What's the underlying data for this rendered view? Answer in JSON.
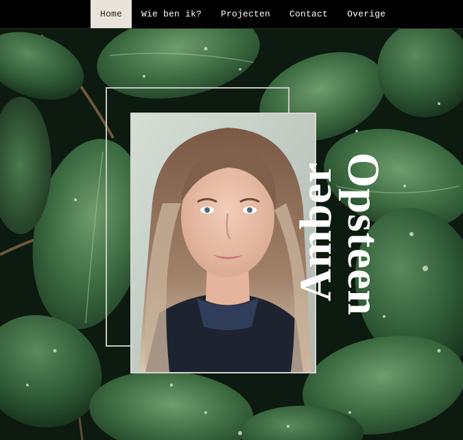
{
  "nav": {
    "items": [
      {
        "label": "Home",
        "active": true
      },
      {
        "label": "Wie ben ik?",
        "active": false
      },
      {
        "label": "Projecten",
        "active": false
      },
      {
        "label": "Contact",
        "active": false
      },
      {
        "label": "Overige",
        "active": false
      }
    ]
  },
  "hero": {
    "first_name": "Amber",
    "last_name": "Opsteen",
    "background": "green-leaves-with-water-drops"
  },
  "colors": {
    "nav_bg": "#000000",
    "nav_active_bg": "#e8e4dc",
    "leaf": "#2f5a36",
    "text": "#ffffff"
  }
}
